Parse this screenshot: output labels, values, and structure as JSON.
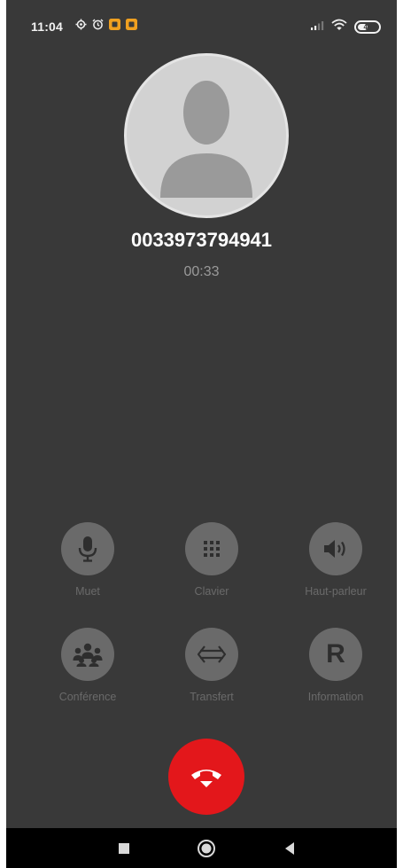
{
  "status_bar": {
    "time": "11:04",
    "battery_level": "48",
    "battery_fraction": 0.48,
    "notification_icons": [
      "settings-icon",
      "alarm-icon",
      "app-notification-icon",
      "app-notification-icon"
    ],
    "system_icons": [
      "signal-icon",
      "wifi-icon",
      "battery-icon"
    ]
  },
  "call": {
    "number": "0033973794941",
    "duration": "00:33"
  },
  "controls": [
    {
      "label": "Muet",
      "icon": "microphone-icon"
    },
    {
      "label": "Clavier",
      "icon": "dialpad-icon"
    },
    {
      "label": "Haut-parleur",
      "icon": "speaker-icon"
    },
    {
      "label": "Conférence",
      "icon": "conference-icon"
    },
    {
      "label": "Transfert",
      "icon": "transfer-icon"
    },
    {
      "label": "Information",
      "icon": "information-icon",
      "glyph": "R"
    }
  ],
  "end_call": {
    "icon": "hang-up-icon"
  },
  "navigation": {
    "buttons": [
      "recents-icon",
      "home-icon",
      "back-icon"
    ]
  },
  "colors": {
    "background": "#393939",
    "control_circle": "#6a6a6a",
    "control_label": "#6a6a6a",
    "end_call": "#e3171b",
    "nav_bar": "#000000",
    "notification_accent": "#f0a020"
  }
}
